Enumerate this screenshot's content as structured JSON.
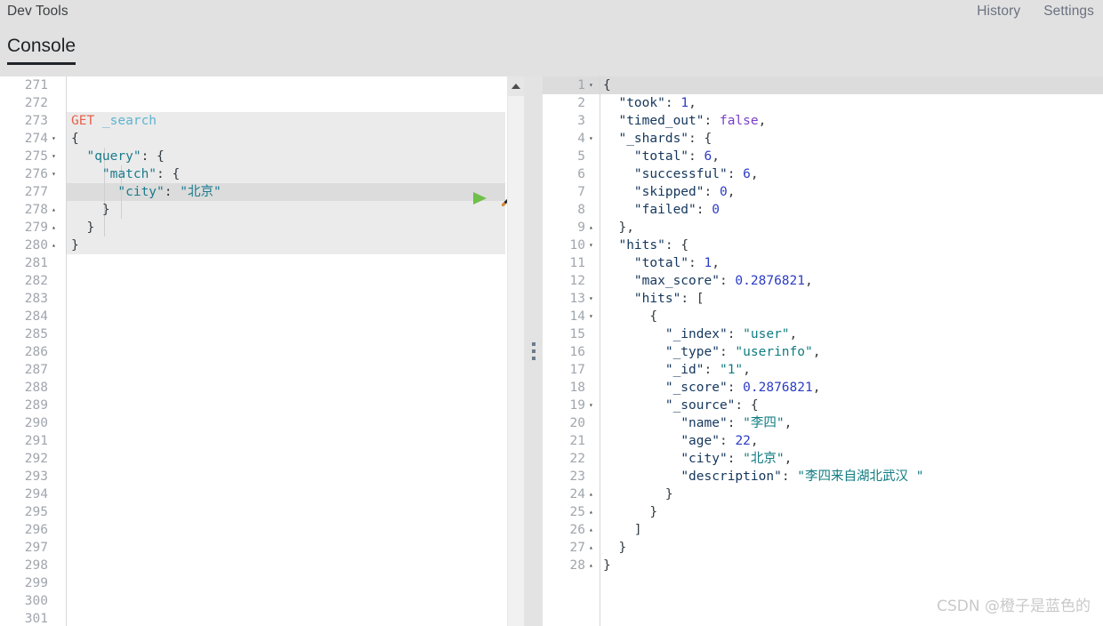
{
  "header": {
    "app_title": "Dev Tools",
    "links": [
      {
        "label": "History",
        "name": "history-link"
      },
      {
        "label": "Settings",
        "name": "settings-link"
      }
    ],
    "tabs": [
      {
        "label": "Console",
        "active": true
      }
    ]
  },
  "editor": {
    "name": "request-editor",
    "first_visible_line": 271,
    "last_visible_line": 301,
    "active_line": 277,
    "request_start_line": 273,
    "request_end_line": 280,
    "run_button_title": "Click to send request",
    "wrench_button_title": "Open documentation / Auto indent",
    "lines": [
      {
        "n": 271,
        "fold": "",
        "tokens": []
      },
      {
        "n": 272,
        "fold": "",
        "tokens": []
      },
      {
        "n": 273,
        "fold": "",
        "tokens": [
          {
            "t": "GET ",
            "c": "tok-method"
          },
          {
            "t": "_search",
            "c": "tok-url"
          }
        ]
      },
      {
        "n": 274,
        "fold": "▾",
        "tokens": [
          {
            "t": "{",
            "c": "tok-punc"
          }
        ]
      },
      {
        "n": 275,
        "fold": "▾",
        "tokens": [
          {
            "t": "  ",
            "c": "tok-punc"
          },
          {
            "t": "\"query\"",
            "c": "tok-key"
          },
          {
            "t": ": {",
            "c": "tok-punc"
          }
        ]
      },
      {
        "n": 276,
        "fold": "▾",
        "tokens": [
          {
            "t": "    ",
            "c": "tok-punc"
          },
          {
            "t": "\"match\"",
            "c": "tok-key"
          },
          {
            "t": ": {",
            "c": "tok-punc"
          }
        ]
      },
      {
        "n": 277,
        "fold": "",
        "tokens": [
          {
            "t": "      ",
            "c": "tok-punc"
          },
          {
            "t": "\"city\"",
            "c": "tok-key"
          },
          {
            "t": ": ",
            "c": "tok-punc"
          },
          {
            "t": "\"北京\"",
            "c": "tok-str"
          }
        ]
      },
      {
        "n": 278,
        "fold": "▴",
        "tokens": [
          {
            "t": "    }",
            "c": "tok-punc"
          }
        ]
      },
      {
        "n": 279,
        "fold": "▴",
        "tokens": [
          {
            "t": "  }",
            "c": "tok-punc"
          }
        ]
      },
      {
        "n": 280,
        "fold": "▴",
        "tokens": [
          {
            "t": "}",
            "c": "tok-punc"
          }
        ]
      },
      {
        "n": 281,
        "fold": "",
        "tokens": []
      },
      {
        "n": 282,
        "fold": "",
        "tokens": []
      },
      {
        "n": 283,
        "fold": "",
        "tokens": []
      },
      {
        "n": 284,
        "fold": "",
        "tokens": []
      },
      {
        "n": 285,
        "fold": "",
        "tokens": []
      },
      {
        "n": 286,
        "fold": "",
        "tokens": []
      },
      {
        "n": 287,
        "fold": "",
        "tokens": []
      },
      {
        "n": 288,
        "fold": "",
        "tokens": []
      },
      {
        "n": 289,
        "fold": "",
        "tokens": []
      },
      {
        "n": 290,
        "fold": "",
        "tokens": []
      },
      {
        "n": 291,
        "fold": "",
        "tokens": []
      },
      {
        "n": 292,
        "fold": "",
        "tokens": []
      },
      {
        "n": 293,
        "fold": "",
        "tokens": []
      },
      {
        "n": 294,
        "fold": "",
        "tokens": []
      },
      {
        "n": 295,
        "fold": "",
        "tokens": []
      },
      {
        "n": 296,
        "fold": "",
        "tokens": []
      },
      {
        "n": 297,
        "fold": "",
        "tokens": []
      },
      {
        "n": 298,
        "fold": "",
        "tokens": []
      },
      {
        "n": 299,
        "fold": "",
        "tokens": []
      },
      {
        "n": 300,
        "fold": "",
        "tokens": []
      },
      {
        "n": 301,
        "fold": "",
        "tokens": []
      }
    ]
  },
  "response": {
    "name": "response-viewer",
    "active_line": 1,
    "lines": [
      {
        "n": 1,
        "fold": "▾",
        "tokens": [
          {
            "t": "{",
            "c": "jpunc"
          }
        ]
      },
      {
        "n": 2,
        "fold": "",
        "tokens": [
          {
            "t": "  ",
            "c": "jpunc"
          },
          {
            "t": "\"took\"",
            "c": "jkey"
          },
          {
            "t": ": ",
            "c": "jpunc"
          },
          {
            "t": "1",
            "c": "jnum"
          },
          {
            "t": ",",
            "c": "jpunc"
          }
        ]
      },
      {
        "n": 3,
        "fold": "",
        "tokens": [
          {
            "t": "  ",
            "c": "jpunc"
          },
          {
            "t": "\"timed_out\"",
            "c": "jkey"
          },
          {
            "t": ": ",
            "c": "jpunc"
          },
          {
            "t": "false",
            "c": "jbool"
          },
          {
            "t": ",",
            "c": "jpunc"
          }
        ]
      },
      {
        "n": 4,
        "fold": "▾",
        "tokens": [
          {
            "t": "  ",
            "c": "jpunc"
          },
          {
            "t": "\"_shards\"",
            "c": "jkey"
          },
          {
            "t": ": {",
            "c": "jpunc"
          }
        ]
      },
      {
        "n": 5,
        "fold": "",
        "tokens": [
          {
            "t": "    ",
            "c": "jpunc"
          },
          {
            "t": "\"total\"",
            "c": "jkey"
          },
          {
            "t": ": ",
            "c": "jpunc"
          },
          {
            "t": "6",
            "c": "jnum"
          },
          {
            "t": ",",
            "c": "jpunc"
          }
        ]
      },
      {
        "n": 6,
        "fold": "",
        "tokens": [
          {
            "t": "    ",
            "c": "jpunc"
          },
          {
            "t": "\"successful\"",
            "c": "jkey"
          },
          {
            "t": ": ",
            "c": "jpunc"
          },
          {
            "t": "6",
            "c": "jnum"
          },
          {
            "t": ",",
            "c": "jpunc"
          }
        ]
      },
      {
        "n": 7,
        "fold": "",
        "tokens": [
          {
            "t": "    ",
            "c": "jpunc"
          },
          {
            "t": "\"skipped\"",
            "c": "jkey"
          },
          {
            "t": ": ",
            "c": "jpunc"
          },
          {
            "t": "0",
            "c": "jnum"
          },
          {
            "t": ",",
            "c": "jpunc"
          }
        ]
      },
      {
        "n": 8,
        "fold": "",
        "tokens": [
          {
            "t": "    ",
            "c": "jpunc"
          },
          {
            "t": "\"failed\"",
            "c": "jkey"
          },
          {
            "t": ": ",
            "c": "jpunc"
          },
          {
            "t": "0",
            "c": "jnum"
          }
        ]
      },
      {
        "n": 9,
        "fold": "▴",
        "tokens": [
          {
            "t": "  },",
            "c": "jpunc"
          }
        ]
      },
      {
        "n": 10,
        "fold": "▾",
        "tokens": [
          {
            "t": "  ",
            "c": "jpunc"
          },
          {
            "t": "\"hits\"",
            "c": "jkey"
          },
          {
            "t": ": {",
            "c": "jpunc"
          }
        ]
      },
      {
        "n": 11,
        "fold": "",
        "tokens": [
          {
            "t": "    ",
            "c": "jpunc"
          },
          {
            "t": "\"total\"",
            "c": "jkey"
          },
          {
            "t": ": ",
            "c": "jpunc"
          },
          {
            "t": "1",
            "c": "jnum"
          },
          {
            "t": ",",
            "c": "jpunc"
          }
        ]
      },
      {
        "n": 12,
        "fold": "",
        "tokens": [
          {
            "t": "    ",
            "c": "jpunc"
          },
          {
            "t": "\"max_score\"",
            "c": "jkey"
          },
          {
            "t": ": ",
            "c": "jpunc"
          },
          {
            "t": "0.2876821",
            "c": "jnum"
          },
          {
            "t": ",",
            "c": "jpunc"
          }
        ]
      },
      {
        "n": 13,
        "fold": "▾",
        "tokens": [
          {
            "t": "    ",
            "c": "jpunc"
          },
          {
            "t": "\"hits\"",
            "c": "jkey"
          },
          {
            "t": ": [",
            "c": "jpunc"
          }
        ]
      },
      {
        "n": 14,
        "fold": "▾",
        "tokens": [
          {
            "t": "      {",
            "c": "jpunc"
          }
        ]
      },
      {
        "n": 15,
        "fold": "",
        "tokens": [
          {
            "t": "        ",
            "c": "jpunc"
          },
          {
            "t": "\"_index\"",
            "c": "jkey"
          },
          {
            "t": ": ",
            "c": "jpunc"
          },
          {
            "t": "\"user\"",
            "c": "jstr"
          },
          {
            "t": ",",
            "c": "jpunc"
          }
        ]
      },
      {
        "n": 16,
        "fold": "",
        "tokens": [
          {
            "t": "        ",
            "c": "jpunc"
          },
          {
            "t": "\"_type\"",
            "c": "jkey"
          },
          {
            "t": ": ",
            "c": "jpunc"
          },
          {
            "t": "\"userinfo\"",
            "c": "jstr"
          },
          {
            "t": ",",
            "c": "jpunc"
          }
        ]
      },
      {
        "n": 17,
        "fold": "",
        "tokens": [
          {
            "t": "        ",
            "c": "jpunc"
          },
          {
            "t": "\"_id\"",
            "c": "jkey"
          },
          {
            "t": ": ",
            "c": "jpunc"
          },
          {
            "t": "\"1\"",
            "c": "jstr"
          },
          {
            "t": ",",
            "c": "jpunc"
          }
        ]
      },
      {
        "n": 18,
        "fold": "",
        "tokens": [
          {
            "t": "        ",
            "c": "jpunc"
          },
          {
            "t": "\"_score\"",
            "c": "jkey"
          },
          {
            "t": ": ",
            "c": "jpunc"
          },
          {
            "t": "0.2876821",
            "c": "jnum"
          },
          {
            "t": ",",
            "c": "jpunc"
          }
        ]
      },
      {
        "n": 19,
        "fold": "▾",
        "tokens": [
          {
            "t": "        ",
            "c": "jpunc"
          },
          {
            "t": "\"_source\"",
            "c": "jkey"
          },
          {
            "t": ": {",
            "c": "jpunc"
          }
        ]
      },
      {
        "n": 20,
        "fold": "",
        "tokens": [
          {
            "t": "          ",
            "c": "jpunc"
          },
          {
            "t": "\"name\"",
            "c": "jkey"
          },
          {
            "t": ": ",
            "c": "jpunc"
          },
          {
            "t": "\"李四\"",
            "c": "jstr"
          },
          {
            "t": ",",
            "c": "jpunc"
          }
        ]
      },
      {
        "n": 21,
        "fold": "",
        "tokens": [
          {
            "t": "          ",
            "c": "jpunc"
          },
          {
            "t": "\"age\"",
            "c": "jkey"
          },
          {
            "t": ": ",
            "c": "jpunc"
          },
          {
            "t": "22",
            "c": "jnum"
          },
          {
            "t": ",",
            "c": "jpunc"
          }
        ]
      },
      {
        "n": 22,
        "fold": "",
        "tokens": [
          {
            "t": "          ",
            "c": "jpunc"
          },
          {
            "t": "\"city\"",
            "c": "jkey"
          },
          {
            "t": ": ",
            "c": "jpunc"
          },
          {
            "t": "\"北京\"",
            "c": "jstr"
          },
          {
            "t": ",",
            "c": "jpunc"
          }
        ]
      },
      {
        "n": 23,
        "fold": "",
        "tokens": [
          {
            "t": "          ",
            "c": "jpunc"
          },
          {
            "t": "\"description\"",
            "c": "jkey"
          },
          {
            "t": ": ",
            "c": "jpunc"
          },
          {
            "t": "\"李四来自湖北武汉 \"",
            "c": "jstr"
          }
        ]
      },
      {
        "n": 24,
        "fold": "▴",
        "tokens": [
          {
            "t": "        }",
            "c": "jpunc"
          }
        ]
      },
      {
        "n": 25,
        "fold": "▴",
        "tokens": [
          {
            "t": "      }",
            "c": "jpunc"
          }
        ]
      },
      {
        "n": 26,
        "fold": "▴",
        "tokens": [
          {
            "t": "    ]",
            "c": "jpunc"
          }
        ]
      },
      {
        "n": 27,
        "fold": "▴",
        "tokens": [
          {
            "t": "  }",
            "c": "jpunc"
          }
        ]
      },
      {
        "n": 28,
        "fold": "▴",
        "tokens": [
          {
            "t": "}",
            "c": "jpunc"
          }
        ]
      }
    ]
  },
  "watermark": "CSDN @橙子是蓝色的",
  "colors": {
    "header_bg": "#e1e1e1",
    "method": "#e8604a",
    "url": "#5fb3ce",
    "json_key": "#14365c",
    "json_string": "#0f7b80",
    "json_number": "#2b3cc4",
    "json_boolean": "#7a3ec8",
    "active_line": "#dcdcdc",
    "request_block": "#ebebeb",
    "run_button": "#6ec04a"
  }
}
